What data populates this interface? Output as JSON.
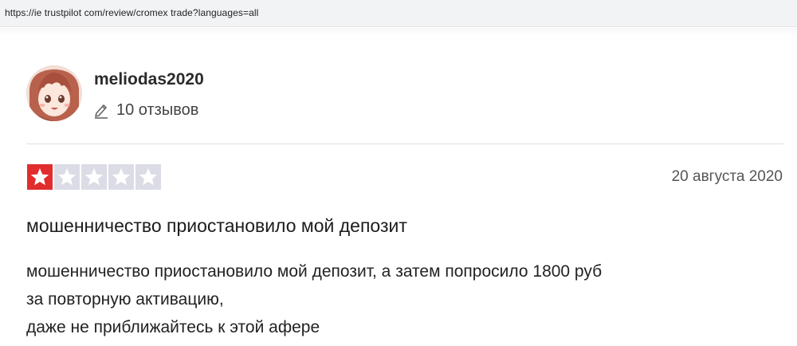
{
  "browser": {
    "url": "https://ie trustpilot com/review/cromex trade?languages=all"
  },
  "reviewer": {
    "name": "meliodas2020",
    "reviews_count": "10 отзывов",
    "avatar_icon": "anime-girl-avatar",
    "pencil_icon": "pencil-icon"
  },
  "review": {
    "rating": 1,
    "rating_max": 5,
    "star_filled_color": "#e12d2d",
    "star_empty_color": "#dcdce6",
    "date": "20 августа 2020",
    "title": "мошенничество приостановило мой депозит",
    "body_lines": [
      "мошенничество приостановило мой депозит, а затем попросило 1800 руб",
      "за повторную активацию,",
      "даже не приближайтесь к этой афере"
    ]
  }
}
